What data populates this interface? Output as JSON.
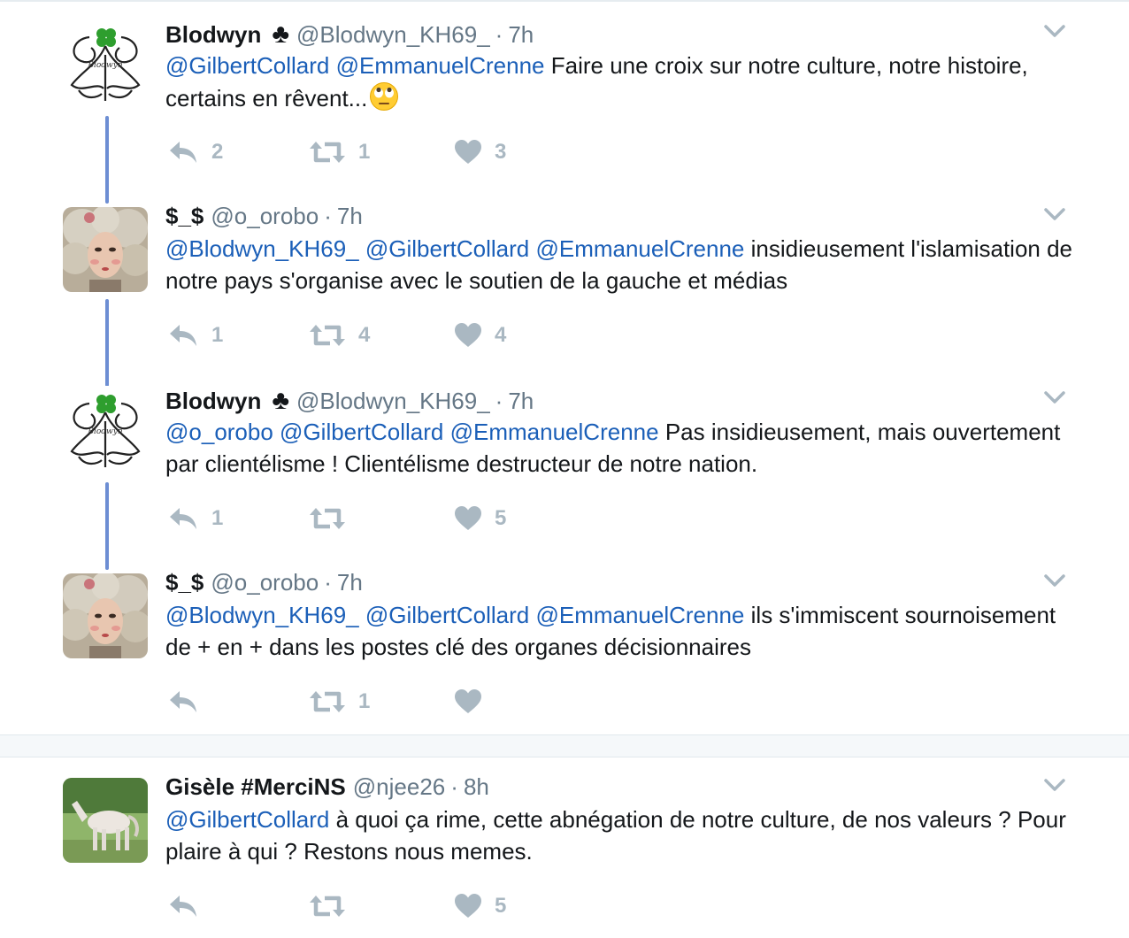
{
  "tweets": [
    {
      "name": "Blodwyn",
      "badge": "♣",
      "handle": "@Blodwyn_KH69_",
      "time": "7h",
      "mentions": [
        "@GilbertCollard",
        "@EmmanuelCrenne"
      ],
      "text": "Faire une croix sur notre culture, notre histoire, certains en rêvent...",
      "replies": "2",
      "retweets": "1",
      "likes": "3"
    },
    {
      "name": "$_$",
      "handle": "@o_orobo",
      "time": "7h",
      "mentions": [
        "@Blodwyn_KH69_",
        "@GilbertCollard",
        "@EmmanuelCrenne"
      ],
      "text": "insidieusement l'islamisation de notre pays s'organise avec le soutien de la gauche et médias",
      "replies": "1",
      "retweets": "4",
      "likes": "4"
    },
    {
      "name": "Blodwyn",
      "badge": "♣",
      "handle": "@Blodwyn_KH69_",
      "time": "7h",
      "mentions": [
        "@o_orobo",
        "@GilbertCollard",
        "@EmmanuelCrenne"
      ],
      "text": "Pas insidieusement, mais ouvertement par clientélisme ! Clientélisme destructeur de notre nation.",
      "replies": "1",
      "retweets": "",
      "likes": "5"
    },
    {
      "name": "$_$",
      "handle": "@o_orobo",
      "time": "7h",
      "mentions": [
        "@Blodwyn_KH69_",
        "@GilbertCollard",
        "@EmmanuelCrenne"
      ],
      "text": "ils s'immiscent sournoisement de + en + dans les postes clé des organes décisionnaires",
      "replies": "",
      "retweets": "1",
      "likes": ""
    },
    {
      "name": "Gisèle #MerciNS",
      "handle": "@njee26",
      "time": "8h",
      "mentions": [
        "@GilbertCollard"
      ],
      "text": "à quoi ça rime, cette abnégation de notre culture, de nos valeurs ? Pour plaire à qui ? Restons nous memes.",
      "replies": "",
      "retweets": "",
      "likes": "5"
    }
  ],
  "separator": "·",
  "icons": {
    "reply": "reply-icon",
    "retweet": "retweet-icon",
    "like": "heart-icon",
    "more": "chevron-down-icon",
    "emoji": "face-with-rolling-eyes-icon"
  },
  "colors": {
    "mention": "#1b5fb8",
    "thread_line": "#6d8ed3",
    "muted": "#657786",
    "action": "#aab8c2"
  }
}
